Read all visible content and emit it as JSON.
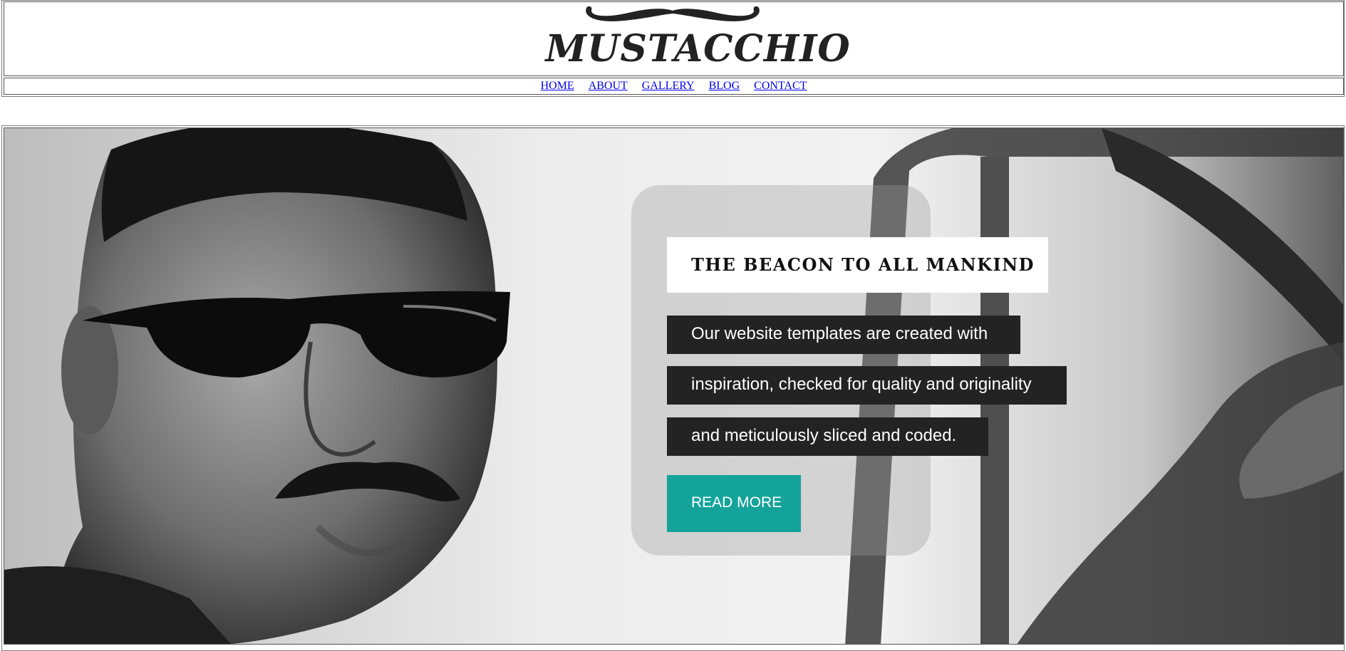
{
  "header": {
    "logo_text": "MUSTACCHIO",
    "logo_icon": "mustache-icon"
  },
  "nav": {
    "items": [
      {
        "label": "HOME"
      },
      {
        "label": "ABOUT"
      },
      {
        "label": "GALLERY"
      },
      {
        "label": "BLOG"
      },
      {
        "label": "CONTACT"
      }
    ]
  },
  "hero": {
    "headline": "THE BEACON TO ALL MANKIND",
    "description_lines": [
      "Our website templates are created with",
      "inspiration, checked for quality and originality",
      "and meticulously sliced and coded."
    ],
    "button_label": "READ MORE",
    "colors": {
      "accent": "#13a39a",
      "text_block": "#232323"
    }
  }
}
